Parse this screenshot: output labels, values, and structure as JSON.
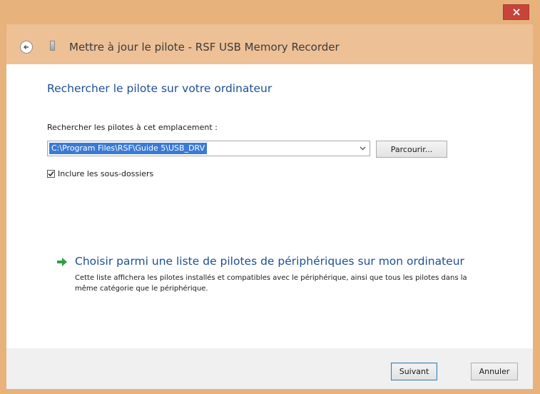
{
  "window": {
    "title": "Mettre à jour le pilote - RSF USB Memory Recorder",
    "close_icon": "close-icon"
  },
  "main": {
    "heading": "Rechercher le pilote sur votre ordinateur",
    "location_label": "Rechercher les pilotes à cet emplacement :",
    "path_value": "C:\\Program Files\\RSF\\Guide 5\\USB_DRV",
    "browse_label": "Parcourir...",
    "include_subfolders_label": "Inclure les sous-dossiers",
    "include_subfolders_checked": true,
    "choose_title": "Choisir parmi une liste de pilotes de périphériques sur mon ordinateur",
    "choose_description": "Cette liste affichera les pilotes installés et compatibles avec le périphérique, ainsi que tous les pilotes dans la même catégorie que le périphérique."
  },
  "footer": {
    "next_label": "Suivant",
    "cancel_label": "Annuler"
  },
  "colors": {
    "frame": "#e7b27c",
    "header": "#eec095",
    "link": "#1d4f96",
    "selection": "#3a7ad5",
    "close": "#c7443a",
    "arrow": "#2ea043"
  }
}
